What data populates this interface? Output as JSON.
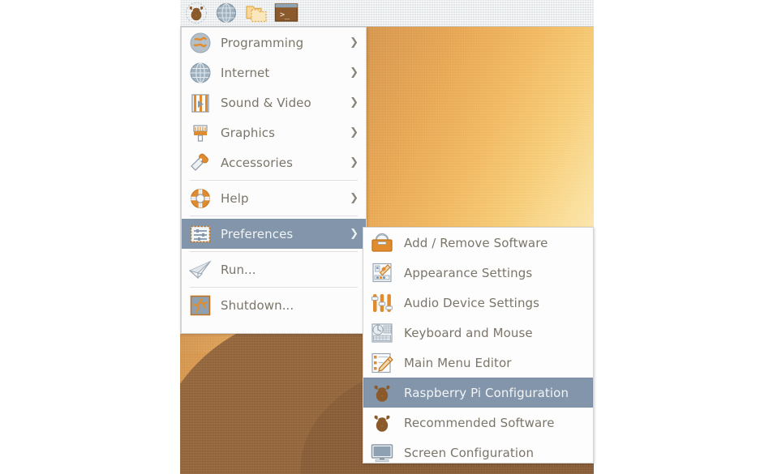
{
  "taskbar": {
    "buttons": [
      {
        "name": "raspberry-menu-button",
        "icon": "raspberry-pi-icon",
        "label": "Menu"
      },
      {
        "name": "web-browser-button",
        "icon": "globe-icon",
        "label": "Web Browser"
      },
      {
        "name": "file-manager-button",
        "icon": "folder-icon",
        "label": "File Manager"
      },
      {
        "name": "terminal-button",
        "icon": "terminal-icon",
        "label": "Terminal"
      }
    ]
  },
  "main_menu": {
    "items": [
      {
        "label": "Programming",
        "icon": "programming-icon",
        "arrow": "❯",
        "has_submenu": true,
        "selected": false
      },
      {
        "label": "Internet",
        "icon": "globe-icon",
        "arrow": "❯",
        "has_submenu": true,
        "selected": false
      },
      {
        "label": "Sound & Video",
        "icon": "sound-video-icon",
        "arrow": "❯",
        "has_submenu": true,
        "selected": false
      },
      {
        "label": "Graphics",
        "icon": "paintbrush-icon",
        "arrow": "❯",
        "has_submenu": true,
        "selected": false
      },
      {
        "label": "Accessories",
        "icon": "swiss-knife-icon",
        "arrow": "❯",
        "has_submenu": true,
        "selected": false
      },
      {
        "label": "Help",
        "icon": "lifebuoy-icon",
        "arrow": "❯",
        "has_submenu": true,
        "selected": false
      },
      {
        "label": "Preferences",
        "icon": "sliders-icon",
        "arrow": "❯",
        "has_submenu": true,
        "selected": true
      },
      {
        "label": "Run...",
        "icon": "paper-plane-icon",
        "arrow": "",
        "has_submenu": false,
        "selected": false
      },
      {
        "label": "Shutdown...",
        "icon": "shutdown-runner-icon",
        "arrow": "",
        "has_submenu": false,
        "selected": false
      }
    ]
  },
  "preferences_submenu": {
    "items": [
      {
        "label": "Add / Remove Software",
        "icon": "software-basket-icon",
        "selected": false
      },
      {
        "label": "Appearance Settings",
        "icon": "appearance-palette-icon",
        "selected": false
      },
      {
        "label": "Audio Device Settings",
        "icon": "audio-sliders-icon",
        "selected": false
      },
      {
        "label": "Keyboard and Mouse",
        "icon": "keyboard-mouse-icon",
        "selected": false
      },
      {
        "label": "Main Menu Editor",
        "icon": "menu-editor-pencil-icon",
        "selected": false
      },
      {
        "label": "Raspberry Pi Configuration",
        "icon": "raspberry-pi-icon",
        "selected": true
      },
      {
        "label": "Recommended Software",
        "icon": "raspberry-pi-icon",
        "selected": false
      },
      {
        "label": "Screen Configuration",
        "icon": "monitor-icon",
        "selected": false
      }
    ]
  },
  "colors": {
    "menu_background": "#fcfcfc",
    "menu_text": "#7b7569",
    "highlight_background": "#8295aa",
    "highlight_text": "#f2f4f6",
    "taskbar_background": "#e3e6e8",
    "raspberry_brown": "#8b5a2b",
    "accent_orange": "#e08c2e"
  }
}
